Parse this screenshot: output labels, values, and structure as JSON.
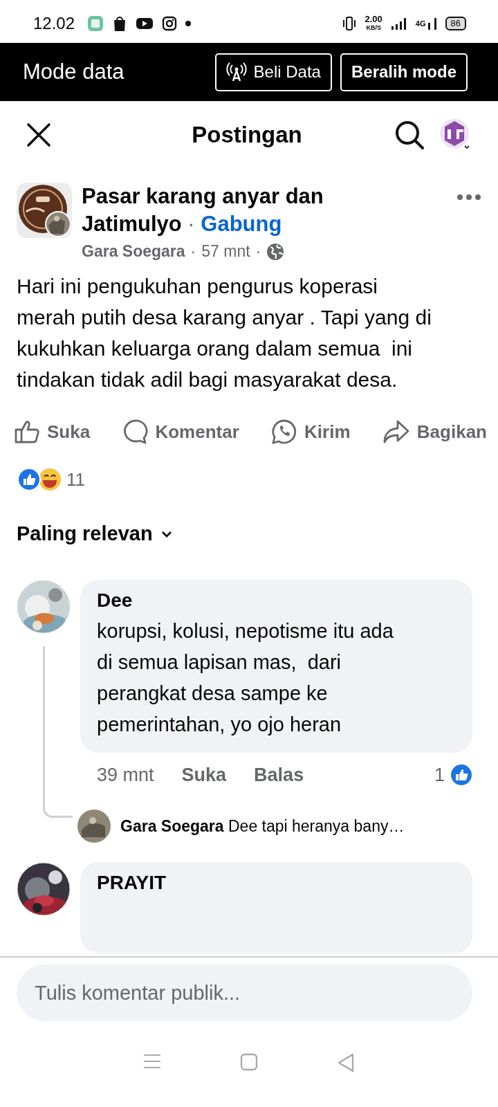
{
  "status_bar": {
    "time": "12.02",
    "speed": "2.00",
    "speed_unit": "KB/S",
    "network": "4G",
    "battery": "86"
  },
  "data_banner": {
    "title": "Mode data",
    "buttons": [
      {
        "label": "Beli Data",
        "kind": "icon"
      },
      {
        "label": "Beralih mode",
        "kind": "plain"
      }
    ]
  },
  "header": {
    "title": "Postingan"
  },
  "post": {
    "separator": "·",
    "group": "Pasar karang anyar dan Jatimulyo",
    "join": "Gabung",
    "author": "Gara Soegara",
    "time": "57 mnt",
    "text": "Hari ini pengukuhan pengurus koperasi merah putih desa karang anyar . Tapi yang di kukuhkan keluarga orang dalam semua  ini tindakan tidak adil bagi masyarakat desa.",
    "actions": [
      {
        "label": "Suka",
        "kind": "like"
      },
      {
        "label": "Komentar",
        "kind": "comment"
      },
      {
        "label": "Kirim",
        "kind": "send"
      },
      {
        "label": "Bagikan",
        "kind": "share"
      }
    ],
    "reactions_count": "11"
  },
  "sort": "Paling relevan",
  "comments": [
    {
      "name": "Dee",
      "text": "korupsi, kolusi, nepotisme itu ada di semua lapisan mas,  dari perangkat desa sampe ke pemerintahan, yo ojo heran",
      "time": "39 mnt",
      "actions": [
        "Suka",
        "Balas"
      ],
      "likes": "1",
      "reply": "**Gara Soegara** Dee tapi heranya bany…"
    },
    {
      "name": "PRAYIT"
    }
  ],
  "composer": {
    "placeholder": "Tulis komentar publik..."
  }
}
